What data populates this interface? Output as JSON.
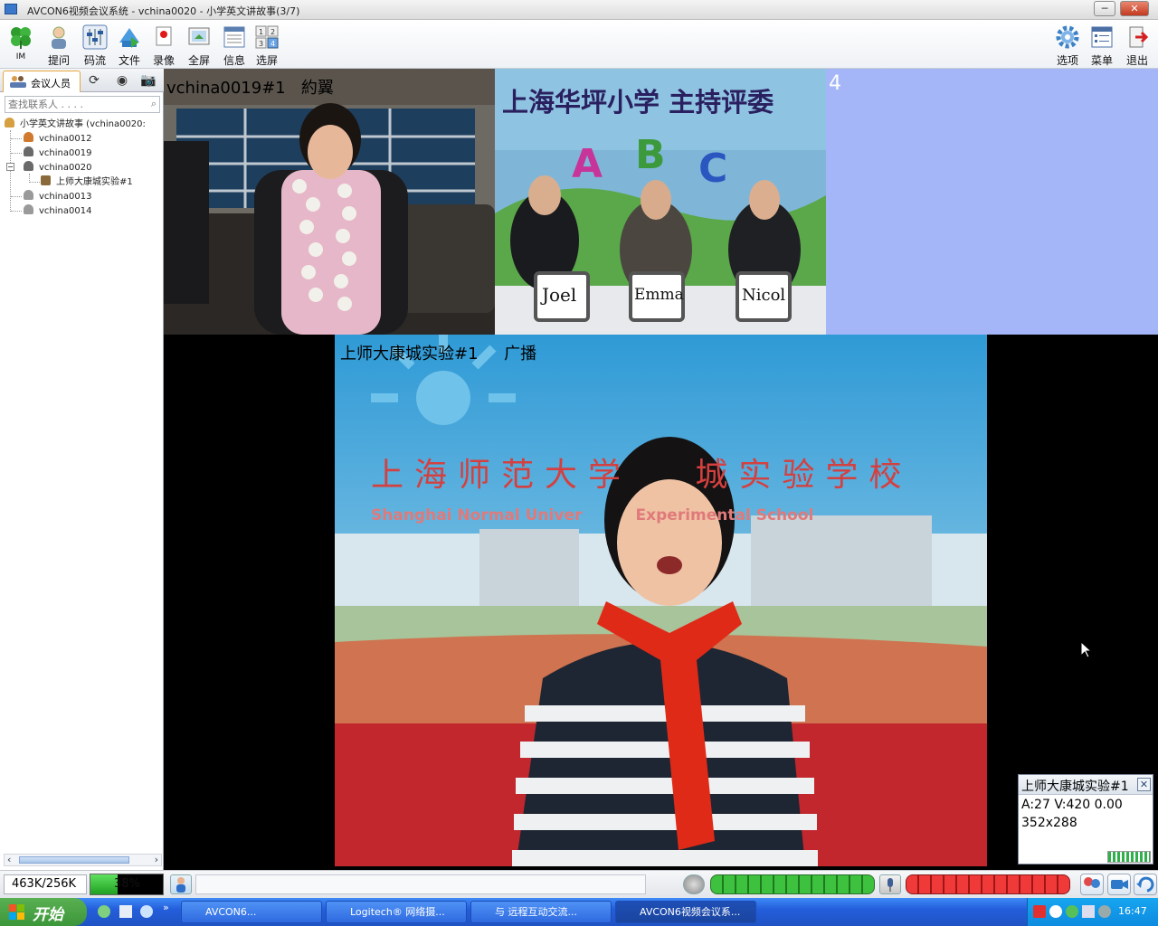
{
  "window": {
    "title": "AVCON6视频会议系统 - vchina0020 - 小学英文讲故事(3/7)",
    "controls": [
      "─",
      "□",
      "✕"
    ]
  },
  "toolbar": {
    "left": [
      {
        "label": "IM",
        "icon": "clover-icon"
      },
      {
        "label": "提问",
        "icon": "ask-question-icon"
      },
      {
        "label": "码流",
        "icon": "bitrate-sliders-icon"
      },
      {
        "label": "文件",
        "icon": "file-transfer-icon"
      },
      {
        "label": "录像",
        "icon": "record-icon"
      },
      {
        "label": "全屏",
        "icon": "fullscreen-icon"
      },
      {
        "label": "信息",
        "icon": "info-panel-icon"
      },
      {
        "label": "选屏",
        "icon": "screen-layout-icon"
      }
    ],
    "right": [
      {
        "label": "选项",
        "icon": "gear-icon"
      },
      {
        "label": "菜单",
        "icon": "menu-icon"
      },
      {
        "label": "退出",
        "icon": "exit-icon"
      }
    ]
  },
  "sidebar": {
    "tab_label": "会议人员",
    "search_placeholder": "查找联系人 . . . .",
    "tree": {
      "root": "小学英文讲故事 (vchina0020:",
      "children": [
        "vchina0012",
        "vchina0019",
        "vchina0020",
        "vchina0013",
        "vchina0014"
      ],
      "sub_item": "上师大康城实验#1"
    }
  },
  "videos": {
    "v1_label": "vchina0019#1",
    "v1_name": "約翼",
    "v2_banner": "上海华坪小学 主持评委",
    "v2_nameplates": [
      "Joel",
      "Emma",
      "Nicol"
    ],
    "v3_number": "4",
    "main_label": "上师大康城实验#1",
    "main_mode": "广播",
    "main_banner_cn": "上海师范大学   城实验学校",
    "main_banner_en": "Shanghai Normal Univer          Experimental School"
  },
  "info_popup": {
    "title": "上师大康城实验#1",
    "line1": "A:27 V:420 0.00",
    "line2": "352x288"
  },
  "statusbar": {
    "bitrate": "463K/256K",
    "cpu_percent": "38%",
    "cpu_level": 0.38
  },
  "taskbar": {
    "start_label": "开始",
    "tasks": [
      "AVCON6...",
      "Logitech® 网络摄...",
      "与 远程互动交流...",
      "AVCON6视频会议系..."
    ],
    "clock": "16:47"
  }
}
